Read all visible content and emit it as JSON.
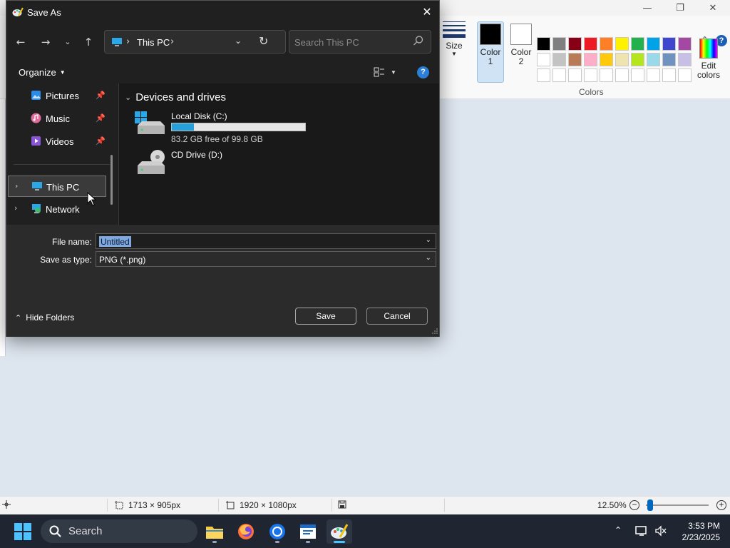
{
  "paint": {
    "ribbon": {
      "size_label": "Size",
      "color1_label": "Color 1",
      "color1_line1": "Color",
      "color1_line2": "1",
      "color2_line1": "Color",
      "color2_line2": "2",
      "colors_group_label": "Colors",
      "edit_colors_line1": "Edit",
      "edit_colors_line2": "colors",
      "color1_value": "#000000",
      "color2_value": "#ffffff",
      "palette": [
        "#000000",
        "#7f7f7f",
        "#880015",
        "#ed1c24",
        "#ff7f27",
        "#fff200",
        "#22b14c",
        "#00a2e8",
        "#3f48cc",
        "#a349a4",
        "#ffffff",
        "#c3c3c3",
        "#b97a57",
        "#ffaec9",
        "#ffc90e",
        "#efe4b0",
        "#b5e61d",
        "#99d9ea",
        "#7092be",
        "#c8bfe7",
        "#ffffff",
        "#ffffff",
        "#ffffff",
        "#ffffff",
        "#ffffff",
        "#ffffff",
        "#ffffff",
        "#ffffff",
        "#ffffff",
        "#ffffff"
      ]
    },
    "statusbar": {
      "selection_size": "1713 × 905px",
      "canvas_size": "1920 × 1080px",
      "zoom": "12.50%",
      "zoom_level": 0.125
    }
  },
  "dialog": {
    "title": "Save As",
    "address": {
      "location": "This PC"
    },
    "search": {
      "placeholder": "Search This PC"
    },
    "organize_label": "Organize",
    "nav_items": [
      {
        "label": "Pictures",
        "icon": "pictures-icon",
        "pinned": true
      },
      {
        "label": "Music",
        "icon": "music-icon",
        "pinned": true
      },
      {
        "label": "Videos",
        "icon": "videos-icon",
        "pinned": true
      },
      {
        "label": "This PC",
        "icon": "this-pc-icon",
        "selected": true
      },
      {
        "label": "Network",
        "icon": "network-icon"
      }
    ],
    "group_header": "Devices and drives",
    "drives": [
      {
        "name": "Local Disk (C:)",
        "free_text": "83.2 GB free of 99.8 GB",
        "used_fraction": 0.166
      },
      {
        "name": "CD Drive (D:)"
      }
    ],
    "file_name_label": "File name:",
    "file_name_value": "Untitled",
    "save_type_label": "Save as type:",
    "save_type_value": "PNG (*.png)",
    "hide_folders_label": "Hide Folders",
    "save_label": "Save",
    "cancel_label": "Cancel"
  },
  "taskbar": {
    "search_label": "Search",
    "time": "3:53 PM",
    "date": "2/23/2025"
  }
}
